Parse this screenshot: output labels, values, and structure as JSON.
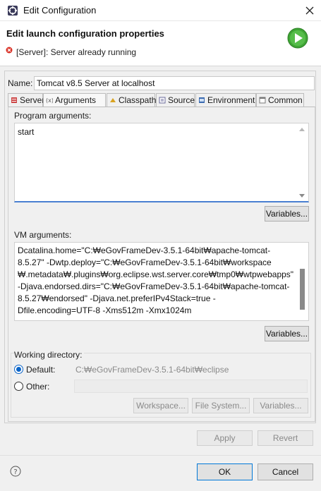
{
  "window": {
    "title": "Edit Configuration",
    "header_title": "Edit launch configuration properties",
    "header_message": "[Server]: Server already running"
  },
  "name": {
    "label": "Name:",
    "value": "Tomcat v8.5 Server at localhost"
  },
  "tabs": [
    {
      "label": "Server",
      "icon": "server-icon",
      "active": false
    },
    {
      "label": "Arguments",
      "icon": "arguments-icon",
      "active": true
    },
    {
      "label": "Classpath",
      "icon": "classpath-icon",
      "active": false
    },
    {
      "label": "Source",
      "icon": "source-icon",
      "active": false
    },
    {
      "label": "Environment",
      "icon": "environment-icon",
      "active": false
    },
    {
      "label": "Common",
      "icon": "common-icon",
      "active": false
    }
  ],
  "program_args": {
    "label": "Program arguments:",
    "value": "start",
    "variables_label": "Variables..."
  },
  "vm_args": {
    "label": "VM arguments:",
    "lines": [
      "Dcatalina.home=\"C:₩eGovFrameDev-3.5.1-64bit₩apache-tomcat-",
      "8.5.27\" -Dwtp.deploy=\"C:₩eGovFrameDev-3.5.1-64bit₩workspace",
      "₩.metadata₩.plugins₩org.eclipse.wst.server.core₩tmp0₩wtpwebapps\"",
      " -Djava.endorsed.dirs=\"C:₩eGovFrameDev-3.5.1-64bit₩apache-tomcat-",
      "8.5.27₩endorsed\" -Djava.net.preferIPv4Stack=true -",
      "Dfile.encoding=UTF-8  -Xms512m -Xmx1024m"
    ],
    "variables_label": "Variables..."
  },
  "working_dir": {
    "label": "Working directory:",
    "default_label": "Default:",
    "default_path": "C:₩eGovFrameDev-3.5.1-64bit₩eclipse",
    "other_label": "Other:",
    "workspace_label": "Workspace...",
    "filesystem_label": "File System...",
    "variables_label": "Variables..."
  },
  "actions": {
    "apply": "Apply",
    "revert": "Revert",
    "ok": "OK",
    "cancel": "Cancel"
  },
  "colors": {
    "accent": "#0078d7",
    "error": "#d93025",
    "run_green": "#3fa535"
  }
}
